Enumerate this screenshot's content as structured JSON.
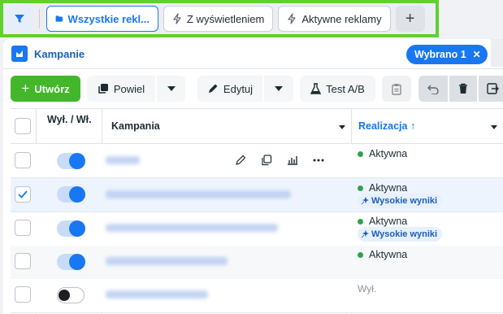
{
  "filterbar": {
    "tabs": [
      {
        "label": "Wszystkie rekl...",
        "active": true,
        "icon": "folder-icon"
      },
      {
        "label": "Z wyświetleniem",
        "active": false,
        "icon": "lightning-icon"
      },
      {
        "label": "Aktywne reklamy",
        "active": false,
        "icon": "lightning-icon"
      }
    ],
    "plus": "+"
  },
  "level_tab": {
    "label": "Kampanie"
  },
  "selection_badge": {
    "label": "Wybrano 1",
    "close": "✕"
  },
  "toolbar": {
    "create_label": "Utwórz",
    "create_plus": "+",
    "duplicate_label": "Powiel",
    "edit_label": "Edytuj",
    "abtest_label": "Test A/B"
  },
  "table": {
    "columns": {
      "toggle": "Wył. / Wł.",
      "campaign": "Kampania",
      "delivery": "Realizacja",
      "sort_arrow": "↑"
    },
    "rows": [
      {
        "selected": false,
        "on": true,
        "status": "Aktywna",
        "badge": "",
        "hover": true
      },
      {
        "selected": true,
        "on": true,
        "status": "Aktywna",
        "badge": "Wysokie wyniki",
        "hover": false
      },
      {
        "selected": false,
        "on": true,
        "status": "Aktywna",
        "badge": "Wysokie wyniki",
        "hover": false
      },
      {
        "selected": false,
        "on": true,
        "status": "Aktywna",
        "badge": "",
        "hover": false
      },
      {
        "selected": false,
        "on": false,
        "status": "Wył.",
        "badge": "",
        "hover": false
      }
    ]
  },
  "colors": {
    "accent": "#1877f2",
    "highlight_border": "#5fd12e",
    "create_button": "#42b72a",
    "active_dot": "#31a24c"
  }
}
